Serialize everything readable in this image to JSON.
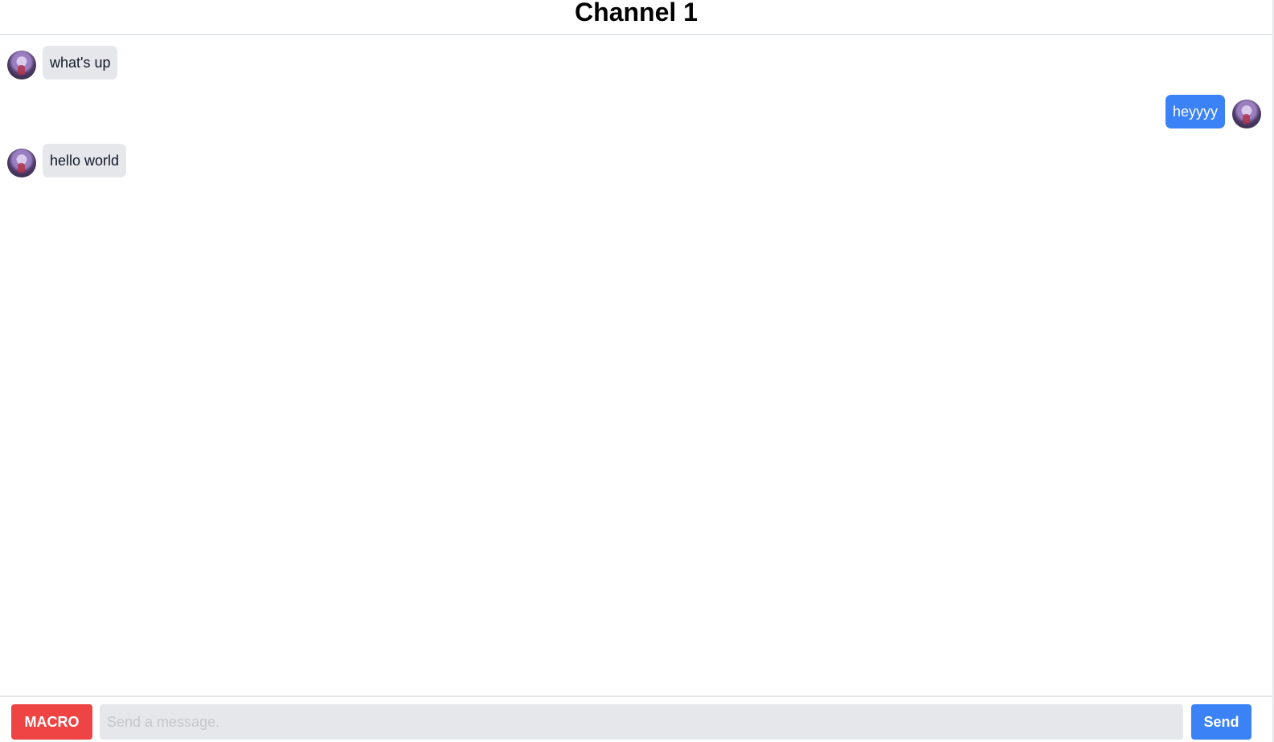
{
  "header": {
    "title": "Channel 1"
  },
  "messages": [
    {
      "text": "what's up",
      "direction": "incoming"
    },
    {
      "text": "heyyyy",
      "direction": "outgoing"
    },
    {
      "text": "hello world",
      "direction": "incoming"
    }
  ],
  "composer": {
    "macro_label": "MACRO",
    "input_placeholder": "Send a message.",
    "input_value": "",
    "send_label": "Send"
  },
  "colors": {
    "outgoing_bubble": "#3b82f6",
    "incoming_bubble": "#e5e7eb",
    "macro_button": "#ef4444",
    "send_button": "#3b82f6"
  },
  "icons": {
    "avatar": "user-avatar-image"
  }
}
